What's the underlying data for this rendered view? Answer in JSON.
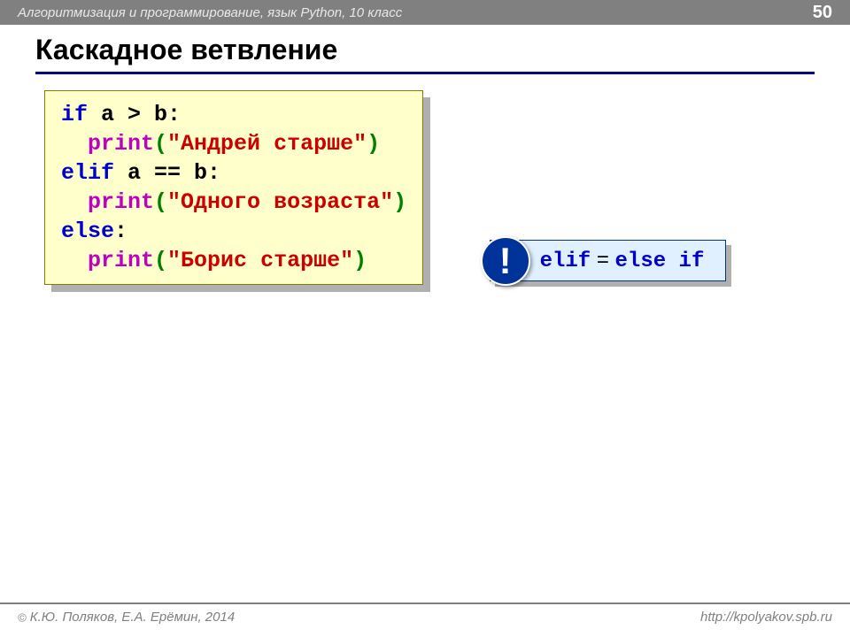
{
  "header": {
    "subject": "Алгоритмизация и программирование, язык Python, 10 класс",
    "page_number": "50"
  },
  "title": "Каскадное ветвление",
  "code": {
    "line1": {
      "kw": "if",
      "rest": " a > b:"
    },
    "line2": {
      "indent": "  ",
      "fn": "print",
      "paren_open": "(",
      "str": "\"Андрей старше\"",
      "paren_close": ")"
    },
    "line3": {
      "kw": "elif",
      "rest": " a == b:"
    },
    "line4": {
      "indent": "  ",
      "fn": "print",
      "paren_open": "(",
      "str": "\"Одного возраста\"",
      "paren_close": ")"
    },
    "line5": {
      "kw": "else",
      "rest": ":"
    },
    "line6": {
      "indent": "  ",
      "fn": "print",
      "paren_open": "(",
      "str": "\"Борис старше\"",
      "paren_close": ")"
    }
  },
  "note": {
    "badge": "!",
    "elif": "elif",
    "eq": " = ",
    "else": "else",
    "if": " if"
  },
  "footer": {
    "copyright": " К.Ю. Поляков, Е.А. Ерёмин, 2014",
    "url": "http://kpolyakov.spb.ru"
  }
}
